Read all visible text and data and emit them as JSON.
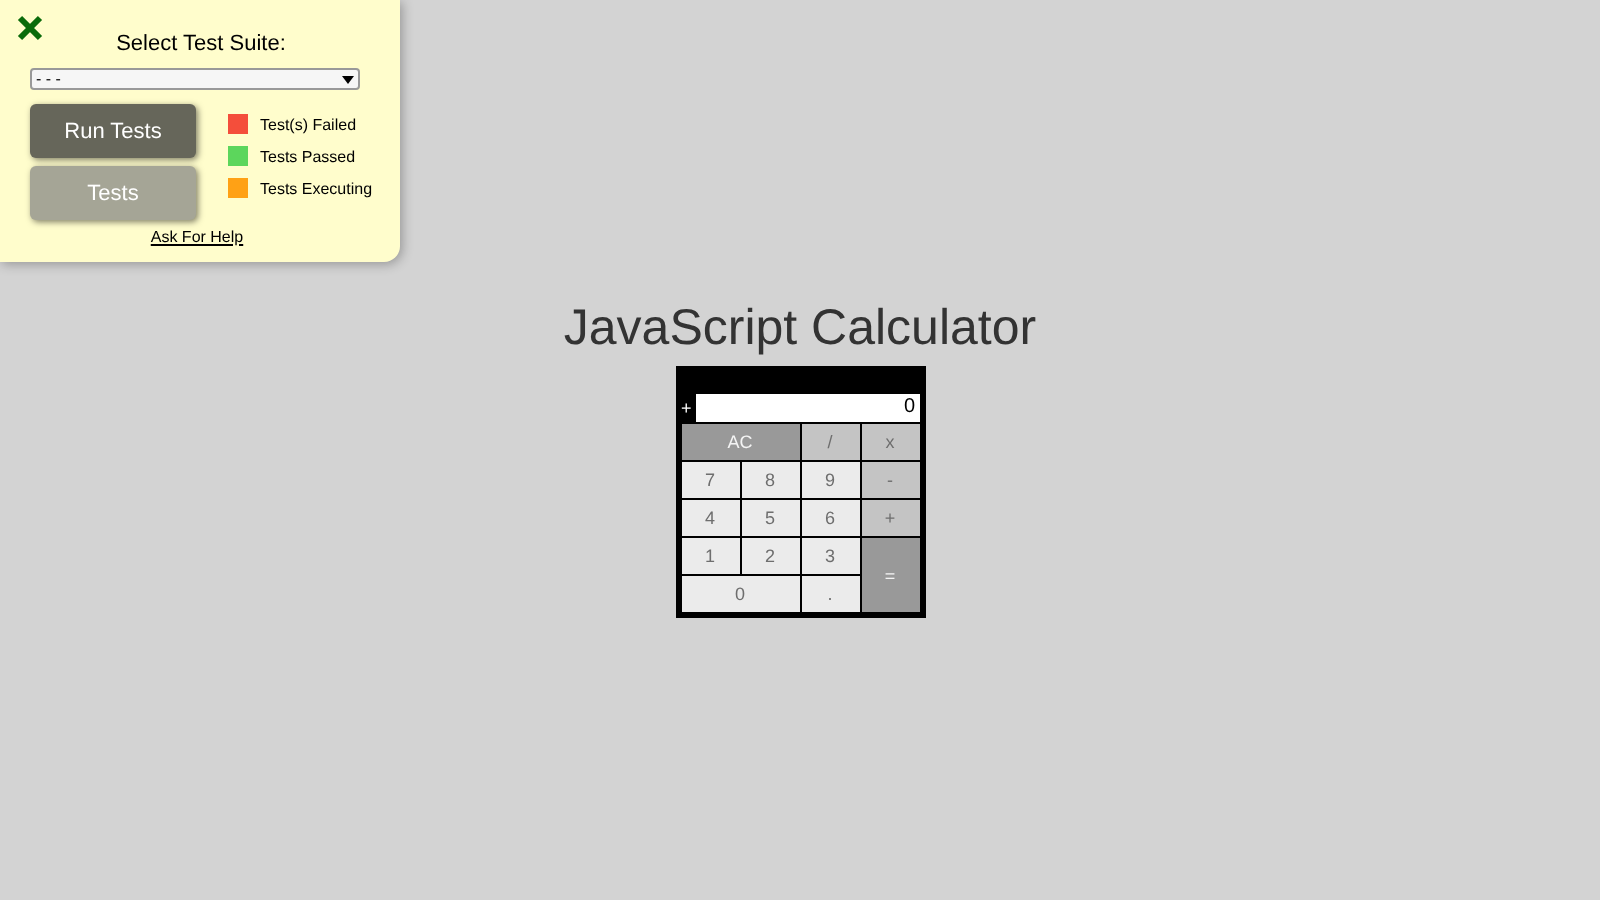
{
  "test_panel": {
    "title": "Select Test Suite:",
    "suite_select": {
      "value": "- - -"
    },
    "buttons": [
      {
        "label": "Run Tests",
        "kind": "primary"
      },
      {
        "label": "Tests",
        "kind": "secondary"
      }
    ],
    "legend": [
      {
        "label": "Test(s) Failed",
        "color": "#f44e3b"
      },
      {
        "label": "Tests Passed",
        "color": "#5cd65c"
      },
      {
        "label": "Tests Executing",
        "color": "#ffa115"
      }
    ],
    "help_link": "Ask For Help"
  },
  "heading": "JavaScript Calculator",
  "calculator": {
    "sign": "+",
    "display": "0",
    "keys": [
      {
        "label": "AC",
        "kind": "clear"
      },
      {
        "label": "/",
        "kind": "operator"
      },
      {
        "label": "x",
        "kind": "operator"
      },
      {
        "label": "7",
        "kind": "digit"
      },
      {
        "label": "8",
        "kind": "digit"
      },
      {
        "label": "9",
        "kind": "digit"
      },
      {
        "label": "-",
        "kind": "operator"
      },
      {
        "label": "4",
        "kind": "digit"
      },
      {
        "label": "5",
        "kind": "digit"
      },
      {
        "label": "6",
        "kind": "digit"
      },
      {
        "label": "+",
        "kind": "operator"
      },
      {
        "label": "1",
        "kind": "digit"
      },
      {
        "label": "2",
        "kind": "digit"
      },
      {
        "label": "3",
        "kind": "digit"
      },
      {
        "label": "=",
        "kind": "equals"
      },
      {
        "label": "0",
        "kind": "zero"
      },
      {
        "label": ".",
        "kind": "digit"
      }
    ]
  }
}
